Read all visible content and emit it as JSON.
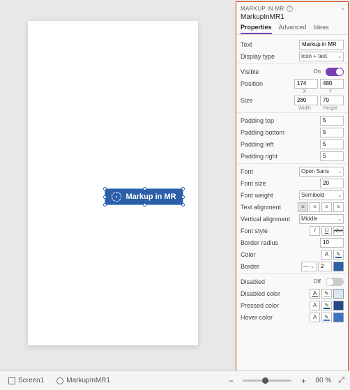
{
  "canvas": {
    "component_label": "Markup in MR"
  },
  "statusbar": {
    "screen": "Screen1",
    "selected": "MarkupInMR1",
    "zoom": "80 %"
  },
  "panel": {
    "header_title": "MARKUP IN MR",
    "object_name": "MarkupInMR1",
    "tabs": {
      "properties": "Properties",
      "advanced": "Advanced",
      "ideas": "Ideas"
    },
    "text": {
      "label": "Text",
      "value": "Markup in MR"
    },
    "display_type": {
      "label": "Display type",
      "value": "Icon + text"
    },
    "visible": {
      "label": "Visible",
      "state": "On"
    },
    "position": {
      "label": "Position",
      "x": "174",
      "y": "480",
      "xl": "X",
      "yl": "Y"
    },
    "size": {
      "label": "Size",
      "w": "280",
      "h": "70",
      "wl": "Width",
      "hl": "Height"
    },
    "padding": {
      "top": {
        "label": "Padding top",
        "value": "5"
      },
      "bottom": {
        "label": "Padding bottom",
        "value": "5"
      },
      "left": {
        "label": "Padding left",
        "value": "5"
      },
      "right": {
        "label": "Padding right",
        "value": "5"
      }
    },
    "font": {
      "label": "Font",
      "value": "Open Sans"
    },
    "font_size": {
      "label": "Font size",
      "value": "20"
    },
    "font_weight": {
      "label": "Font weight",
      "value": "Semibold"
    },
    "text_align": {
      "label": "Text alignment"
    },
    "vert_align": {
      "label": "Vertical alignment",
      "value": "Middle"
    },
    "font_style": {
      "label": "Font style"
    },
    "border_radius": {
      "label": "Border radius",
      "value": "10"
    },
    "color": {
      "label": "Color"
    },
    "border": {
      "label": "Border",
      "width": "2"
    },
    "disabled": {
      "label": "Disabled",
      "state": "Off"
    },
    "disabled_color": {
      "label": "Disabled color"
    },
    "pressed_color": {
      "label": "Pressed color"
    },
    "hover_color": {
      "label": "Hover color"
    }
  }
}
